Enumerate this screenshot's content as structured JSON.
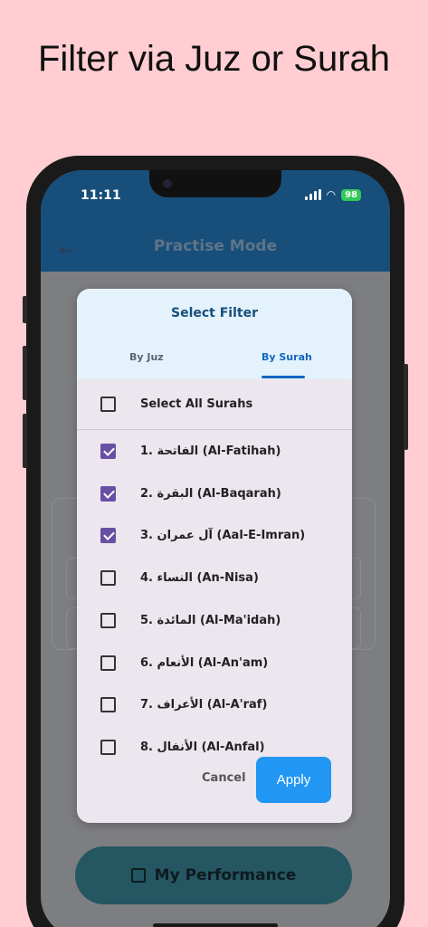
{
  "headline": "Filter via Juz or Surah",
  "status": {
    "time": "11:11",
    "battery": "98"
  },
  "app": {
    "title": "Practise Mode",
    "performance_label": "My Performance"
  },
  "dialog": {
    "title": "Select Filter",
    "tabs": [
      {
        "label": "By Juz",
        "active": false
      },
      {
        "label": "By Surah",
        "active": true
      }
    ],
    "select_all_label": "Select All Surahs",
    "select_all_checked": false,
    "surahs": [
      {
        "label": "1. الفاتحة (Al-Fatihah)",
        "checked": true
      },
      {
        "label": "2. البقرة (Al-Baqarah)",
        "checked": true
      },
      {
        "label": "3. آل عمران (Aal-E-Imran)",
        "checked": true
      },
      {
        "label": "4. النساء (An-Nisa)",
        "checked": false
      },
      {
        "label": "5. المائدة (Al-Ma'idah)",
        "checked": false
      },
      {
        "label": "6. الأنعام (Al-An'am)",
        "checked": false
      },
      {
        "label": "7. الأعراف (Al-A'raf)",
        "checked": false
      },
      {
        "label": "8. الأنفال (Al-Anfal)",
        "checked": false
      }
    ],
    "cancel_label": "Cancel",
    "apply_label": "Apply"
  },
  "colors": {
    "accent": "#2196F3",
    "appbar": "#174E7A",
    "checkbox": "#6750A4",
    "background": "#FFCDD2"
  }
}
